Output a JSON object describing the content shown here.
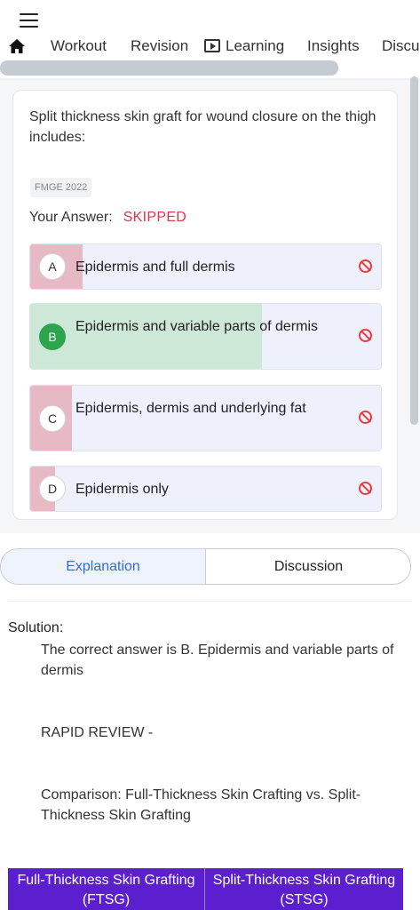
{
  "nav": {
    "items": [
      "Workout",
      "Revision",
      "Learning",
      "Insights",
      "Discu"
    ]
  },
  "question": {
    "text": "Split thickness skin graft for wound closure on the thigh includes:",
    "tag": "FMGE 2022",
    "answer_label": "Your Answer:",
    "answer_value": "SKIPPED"
  },
  "options": [
    {
      "letter": "A",
      "text": "Epidermis and full dermis",
      "percent": 15,
      "correct": false
    },
    {
      "letter": "B",
      "text": "Epidermis and variable parts of dermis",
      "percent": 66,
      "correct": true
    },
    {
      "letter": "C",
      "text": "Epidermis, dermis and underlying fat",
      "percent": 12,
      "correct": false
    },
    {
      "letter": "D",
      "text": "Epidermis only",
      "percent": 7,
      "correct": false
    }
  ],
  "tabs": {
    "explanation": "Explanation",
    "discussion": "Discussion"
  },
  "solution": {
    "label": "Solution:",
    "answer": "The correct answer is B. Epidermis and variable parts of dermis",
    "rapid_review": "RAPID REVIEW -",
    "comparison": "Comparison: Full-Thickness Skin Crafting vs. Split-Thickness Skin Grafting",
    "table_headers": [
      "Full-Thickness Skin Grafting (FTSG)",
      "Split-Thickness Skin Grafting (STSG)"
    ]
  },
  "colors": {
    "accent": "#2f6fd6",
    "wrong_fill": "#e6b9c4",
    "correct_fill": "#cde8d6",
    "skipped": "#e0354a",
    "table_header": "#5b1fd0"
  }
}
